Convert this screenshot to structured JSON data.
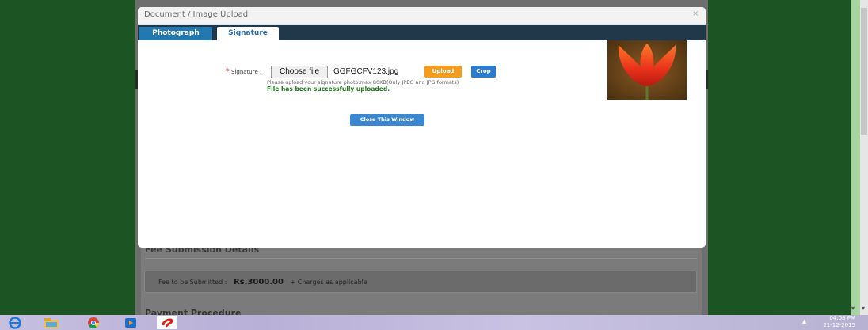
{
  "modal": {
    "title": "Document / Image Upload",
    "close_label": "×",
    "tabs": [
      {
        "label": "Photograph",
        "active": false
      },
      {
        "label": "Signature",
        "active": true
      }
    ],
    "signature": {
      "required_mark": "*",
      "label": "Signature :",
      "choose_file_label": "Choose file",
      "file_name": "GGFGCFV123.jpg",
      "upload_label": "Upload",
      "crop_label": "Crop",
      "hint": "Please upload your signature photo:max 80KB(Only JPEG and JPG formats)",
      "success_message": "File has been successfully uploaded."
    },
    "close_window_label": "Close This Window",
    "preview_image": "tulip-preview"
  },
  "background": {
    "fee_title": "Fee Submission Details",
    "fee_label": "Fee to be Submitted :",
    "fee_amount": "Rs.3000.00",
    "fee_note": "+ Charges as applicable",
    "payment_title": "Payment Procedure"
  },
  "taskbar": {
    "icons": [
      "internet-explorer-icon",
      "file-explorer-icon",
      "chrome-icon",
      "media-player-icon",
      "airtel-icon"
    ],
    "time": "04:08 PM",
    "date": "21-12-2015"
  },
  "colors": {
    "background_green": "#1d5423",
    "tab_bar": "#21374a",
    "upload_button": "#f39c1f",
    "crop_button": "#2b7ccf",
    "success_green": "#1c7a18"
  }
}
